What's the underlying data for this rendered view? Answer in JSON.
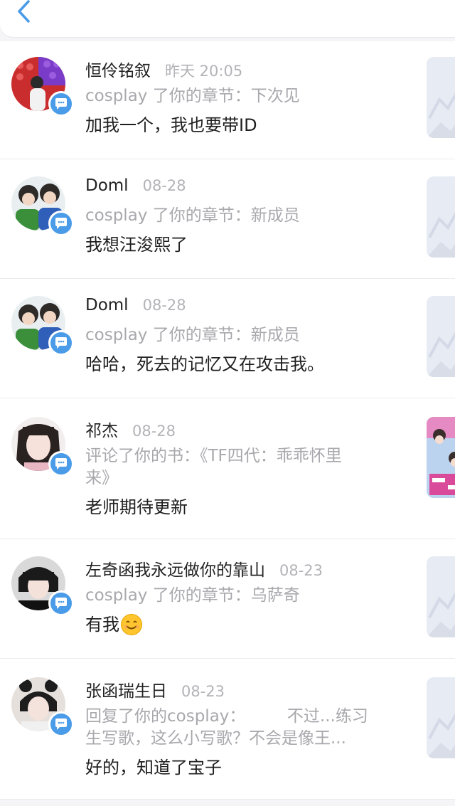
{
  "header": {
    "back_icon": "chevron-left-icon"
  },
  "notifications": [
    {
      "name": "恒伶铭叙",
      "time": "昨天 20:05",
      "action": "cosplay 了你的章节：下次见",
      "content": "加我一个，我也要带ID",
      "avatar_color": "#d33a3a"
    },
    {
      "name": "Doml",
      "time": "08-28",
      "action": "cosplay 了你的章节：新成员",
      "content": "我想汪浚熙了",
      "avatar_color": "#2f6bb8"
    },
    {
      "name": "Doml",
      "time": "08-28",
      "action": "cosplay 了你的章节：新成员",
      "content": "哈哈，死去的记忆又在攻击我。",
      "avatar_color": "#2f6bb8"
    },
    {
      "name": "祁杰",
      "time": "08-28",
      "action_line1": "评论了你的书：《TF四代：乖乖怀里",
      "action_line2": "来》",
      "content": "老师期待更新",
      "avatar_color": "#e9d9d4"
    },
    {
      "name": "左奇函我永远做你的靠山",
      "time": "08-23",
      "action": "cosplay 了你的章节：乌萨奇",
      "content": "有我",
      "emoji": "smile-emoji",
      "avatar_color": "#1a1a1a"
    },
    {
      "name": "张函瑞生日",
      "time": "08-23",
      "action_line1": "回复了你的cosplay：        不过...练习",
      "action_line2": "生写歌，这么小写歌？不会是像王...",
      "content": "好的，知道了宝子",
      "avatar_color": "#222222"
    }
  ],
  "colors": {
    "accent": "#4a9be8",
    "name_text": "#222222",
    "muted_text": "#a8a8ad"
  }
}
